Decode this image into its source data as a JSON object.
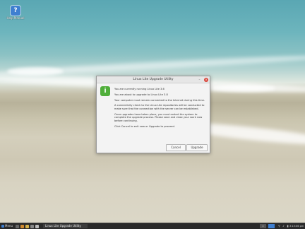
{
  "desktop": {
    "icon_label": "Help Manual"
  },
  "dialog": {
    "title": "Linux Lite Upgrade Utility",
    "paragraphs": [
      "You are currently running Linux Lite 3.6",
      "You are about to upgrade to Linux Lite 3.8",
      "Your computer must remain connected to the Internet during this time.",
      "A connectivity check to the Linux Lite repositories will be conducted to make sure that the connection with the server can be established.",
      "Once upgrades have taken place, you must restart the system to complete the upgrade process. Please save and close your work now before continuing.",
      "Click Cancel to exit now or Upgrade to proceed."
    ],
    "cancel_label": "Cancel",
    "upgrade_label": "Upgrade"
  },
  "taskbar": {
    "menu_label": "Menu",
    "task_label": "Linux Lite Upgrade Utility",
    "clock": "3:15:06 pm"
  },
  "colors": {
    "sea": "#5aa7b3",
    "sand": "#d4cfbc",
    "close": "#d9453a",
    "dialog_icon": "#4fae3a",
    "accent": "#3f7fd0"
  }
}
